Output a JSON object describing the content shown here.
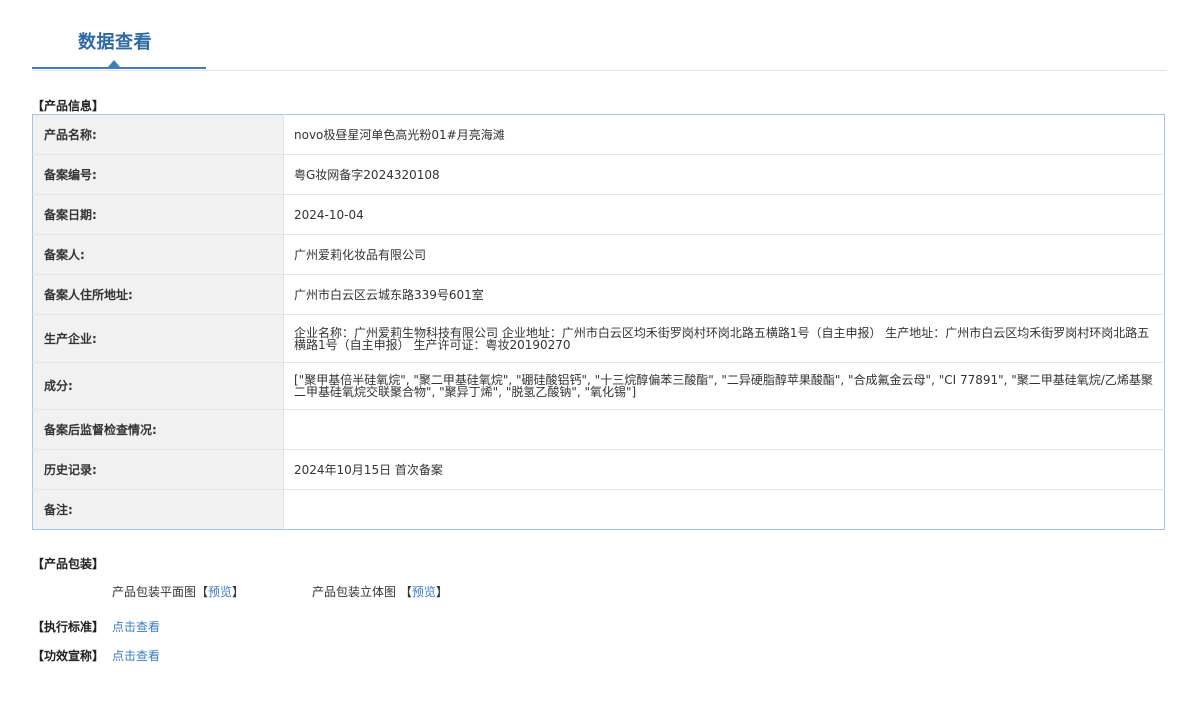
{
  "page": {
    "title": "数据查看"
  },
  "product_info": {
    "heading": "【产品信息】",
    "rows": [
      {
        "label": "产品名称:",
        "value": "novo极昼星河单色高光粉01#月亮海滩"
      },
      {
        "label": "备案编号:",
        "value": "粤G妆网备字2024320108"
      },
      {
        "label": "备案日期:",
        "value": "2024-10-04"
      },
      {
        "label": "备案人:",
        "value": "广州爱莉化妆品有限公司"
      },
      {
        "label": "备案人住所地址:",
        "value": "广州市白云区云城东路339号601室"
      },
      {
        "label": "生产企业:",
        "value": "企业名称：广州爱莉生物科技有限公司 企业地址：广州市白云区均禾街罗岗村环岗北路五横路1号（自主申报） 生产地址：广州市白云区均禾街罗岗村环岗北路五横路1号（自主申报） 生产许可证：粤妆20190270"
      },
      {
        "label": "成分:",
        "value": "[\"聚甲基倍半硅氧烷\", \"聚二甲基硅氧烷\", \"硼硅酸铝钙\", \"十三烷醇偏苯三酸酯\", \"二异硬脂醇苹果酸酯\", \"合成氟金云母\", \"CI 77891\", \"聚二甲基硅氧烷/乙烯基聚二甲基硅氧烷交联聚合物\", \"聚异丁烯\", \"脱氢乙酸钠\", \"氧化锡\"]"
      },
      {
        "label": "备案后监督检查情况:",
        "value": ""
      },
      {
        "label": "历史记录:",
        "value": "2024年10月15日 首次备案"
      },
      {
        "label": "备注:",
        "value": ""
      }
    ]
  },
  "packaging": {
    "heading": "【产品包装】",
    "flat_label": "产品包装平面图",
    "stereo_label": "产品包装立体图",
    "open_bracket": "【",
    "close_bracket": "】",
    "preview": "预览"
  },
  "standard": {
    "label": "【执行标准】",
    "link": "点击查看"
  },
  "efficacy": {
    "label": "【功效宣称】",
    "link": "点击查看"
  }
}
